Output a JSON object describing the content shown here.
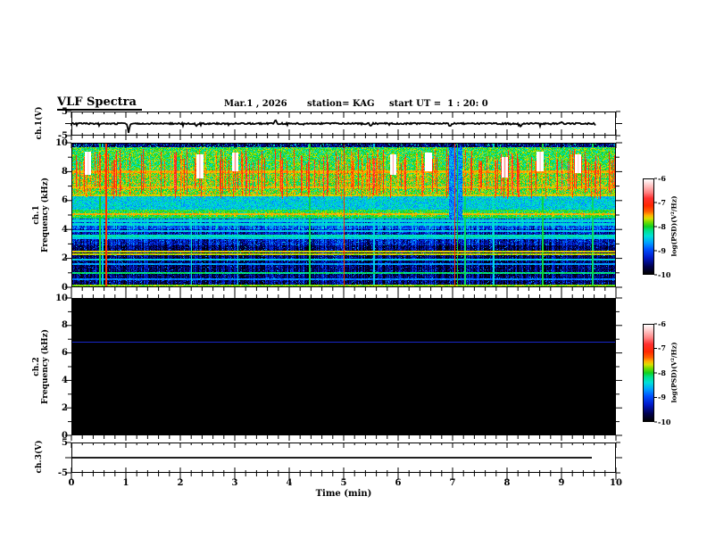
{
  "header": {
    "title": "VLF Spectra",
    "date": "Mar.1 , 2026",
    "station": "station= KAG",
    "start_ut": "start UT =  1 : 20: 0"
  },
  "panels": {
    "ch1v": {
      "label": "ch.1(V)",
      "ytick_labels": [
        5,
        -5
      ]
    },
    "ch1f": {
      "label_line1": "ch.1",
      "label_line2": "Frequency (kHz)",
      "ytick_labels": [
        10,
        8,
        6,
        4,
        2,
        0
      ]
    },
    "ch2f": {
      "label_line1": "ch.2",
      "label_line2": "Frequency (kHz)",
      "ytick_labels": [
        10,
        8,
        6,
        4,
        2,
        0
      ]
    },
    "ch3v": {
      "label": "ch.3(V)",
      "ytick_labels": [
        5,
        -5
      ]
    }
  },
  "xaxis": {
    "label": "Time (min)",
    "ticks": [
      0,
      1,
      2,
      3,
      4,
      5,
      6,
      7,
      8,
      9,
      10
    ],
    "minor_step": 0.2,
    "range": [
      0,
      10
    ]
  },
  "colorbar": {
    "label": "log(PSD)(V²/Hz)",
    "ticks": [
      -6,
      -7,
      -8,
      -9,
      -10
    ],
    "range": [
      -10,
      -6
    ],
    "stops": [
      [
        0,
        "#000000"
      ],
      [
        0.08,
        "#000050"
      ],
      [
        0.17,
        "#0018c8"
      ],
      [
        0.26,
        "#0050ff"
      ],
      [
        0.33,
        "#00a0ff"
      ],
      [
        0.4,
        "#00e0d8"
      ],
      [
        0.46,
        "#00e088"
      ],
      [
        0.5,
        "#10d020"
      ],
      [
        0.55,
        "#78dc00"
      ],
      [
        0.585,
        "#d8e000"
      ],
      [
        0.62,
        "#ffb000"
      ],
      [
        0.66,
        "#ff6000"
      ],
      [
        0.72,
        "#ff2800"
      ],
      [
        0.8,
        "#ff3030"
      ],
      [
        0.86,
        "#ff8080"
      ],
      [
        0.92,
        "#ffb8b8"
      ],
      [
        1,
        "#ffffff"
      ]
    ]
  },
  "chart_data": [
    {
      "type": "line",
      "name": "ch1_voltage",
      "ylabel": "ch.1(V)",
      "ylim": [
        -5,
        5
      ],
      "xlim": [
        0,
        10
      ],
      "baseline": 0,
      "noise_amp": 0.3,
      "downtick_prob": 0.035,
      "downtick_amp": 1.1,
      "end_t": 9.62,
      "spikes": [
        {
          "t": 1.05,
          "a": -4.0
        },
        {
          "t": 2.3,
          "a": -1.0
        },
        {
          "t": 3.75,
          "a": 1.6
        },
        {
          "t": 5.5,
          "a": -1.0
        },
        {
          "t": 6.95,
          "a": -1.3
        },
        {
          "t": 8.25,
          "a": -1.6
        },
        {
          "t": 9.0,
          "a": 0.7
        }
      ]
    },
    {
      "type": "heatmap",
      "name": "ch1_spectrogram",
      "ylim": [
        0,
        10
      ],
      "xlim": [
        0,
        10
      ],
      "value_range": [
        -10,
        -6
      ],
      "seed": 1337,
      "bands": [
        {
          "f0": 9.7,
          "f1": 10.01,
          "base": -9.55,
          "noise": 0.35,
          "speckle_prob": 0.12,
          "speckle_v": -8.3
        },
        {
          "f0": 8.0,
          "f1": 9.7,
          "base": -8.0,
          "noise": 0.4
        },
        {
          "f0": 6.3,
          "f1": 8.0,
          "base": -7.85,
          "noise": 0.45
        },
        {
          "f0": 5.4,
          "f1": 6.3,
          "base": -8.45,
          "noise": 0.35
        },
        {
          "f0": 4.9,
          "f1": 5.4,
          "base": -8.0,
          "noise": 0.3
        },
        {
          "f0": 4.0,
          "f1": 4.9,
          "base": -8.95,
          "noise": 0.4,
          "speckle_prob": 0.05,
          "speckle_v": -8.4
        },
        {
          "f0": 2.9,
          "f1": 4.0,
          "base": -9.3,
          "noise": 0.35,
          "speckle_prob": 0.05,
          "speckle_v": -8.6
        },
        {
          "f0": 0,
          "f1": 2.9,
          "base": -9.6,
          "noise": 0.3,
          "speckle_prob": 0.04,
          "speckle_v": -8.8
        }
      ],
      "carriers": [
        {
          "f": 8.0,
          "v": -7.55
        },
        {
          "f": 6.9,
          "v": -7.6
        },
        {
          "f": 6.35,
          "v": -7.7
        },
        {
          "f": 5.05,
          "v": -7.55
        },
        {
          "f": 4.85,
          "v": -8.1
        },
        {
          "f": 4.6,
          "v": -8.45
        },
        {
          "f": 4.35,
          "v": -8.45
        },
        {
          "f": 3.9,
          "v": -8.5
        },
        {
          "f": 3.55,
          "v": -8.3
        },
        {
          "f": 3.4,
          "v": -8.55
        },
        {
          "f": 2.45,
          "v": -7.65
        },
        {
          "f": 2.28,
          "v": -7.7
        },
        {
          "f": 1.9,
          "v": -8.5
        },
        {
          "f": 1.6,
          "v": -8.7
        },
        {
          "f": 1.0,
          "v": -8.15
        },
        {
          "f": 0.55,
          "v": -8.8
        },
        {
          "f": 0.12,
          "v": -7.8
        }
      ],
      "verticals": [
        {
          "t": 0.52,
          "v": -8.0,
          "f0": 0,
          "f1": 10
        },
        {
          "t": 0.57,
          "v": -8.5,
          "f0": 0,
          "f1": 10
        },
        {
          "t": 0.63,
          "v": -7.15,
          "f0": 0,
          "f1": 10
        },
        {
          "t": 2.2,
          "v": -8.4,
          "f0": 0,
          "f1": 6
        },
        {
          "t": 3.05,
          "v": -8.5,
          "f0": 0,
          "f1": 10
        },
        {
          "t": 4.37,
          "v": -8.05,
          "f0": 0,
          "f1": 10
        },
        {
          "t": 5.0,
          "v": -7.2,
          "f0": 0,
          "f1": 10
        },
        {
          "t": 5.55,
          "v": -8.5,
          "f0": 0,
          "f1": 10
        },
        {
          "t": 7.03,
          "v": -7.2,
          "f0": 0,
          "f1": 10
        },
        {
          "t": 7.08,
          "v": -8.0,
          "f0": 0,
          "f1": 10
        },
        {
          "t": 7.22,
          "v": -8.1,
          "f0": 0,
          "f1": 7
        },
        {
          "t": 7.75,
          "v": -8.45,
          "f0": 0,
          "f1": 10
        },
        {
          "t": 8.65,
          "v": -8.05,
          "f0": 0,
          "f1": 10
        },
        {
          "t": 9.57,
          "v": -8.1,
          "f0": 0,
          "f1": 10
        }
      ],
      "streaks": {
        "prob": 0.32,
        "f_top_min": 8.5,
        "f_top_span": 1.1,
        "f_bot_min": 6.1,
        "f_bot_span": 0.9,
        "v": -7.25,
        "v_jitter": 0.45
      },
      "events": [
        {
          "t": 0.3,
          "f0": 7.8,
          "f1": 9.4,
          "v": -6.3
        },
        {
          "t": 2.35,
          "f0": 7.5,
          "f1": 9.2,
          "v": -6.4
        },
        {
          "t": 3.0,
          "f0": 8.0,
          "f1": 9.3,
          "v": -6.5
        },
        {
          "t": 5.9,
          "f0": 7.8,
          "f1": 9.2,
          "v": -6.4
        },
        {
          "t": 6.55,
          "f0": 8.0,
          "f1": 9.3,
          "v": -6.15
        },
        {
          "t": 7.95,
          "f0": 7.6,
          "f1": 9.0,
          "v": -6.5
        },
        {
          "t": 8.6,
          "f0": 8.0,
          "f1": 9.4,
          "v": -6.35
        },
        {
          "t": 9.3,
          "f0": 7.9,
          "f1": 9.2,
          "v": -6.3
        }
      ],
      "event_halfwidth": 0.06,
      "dark_band": {
        "t0": 6.93,
        "t1": 7.18,
        "f_min": 4.6,
        "v": -9.1,
        "jitter": 0.7
      },
      "col_mod_below_f": 5.2,
      "col_mod_amp": 0.45
    },
    {
      "type": "heatmap",
      "name": "ch2_spectrogram",
      "ylim": [
        0,
        10
      ],
      "xlim": [
        0,
        10
      ],
      "background": "#000000",
      "lines": [
        {
          "f": 6.8,
          "color": "#1828cc"
        }
      ]
    },
    {
      "type": "line",
      "name": "ch3_voltage",
      "ylabel": "ch.3(V)",
      "ylim": [
        -5,
        5
      ],
      "xlim": [
        0,
        10
      ],
      "baseline": 0,
      "noise_amp": 0,
      "end_t": 9.56,
      "spikes": []
    }
  ]
}
